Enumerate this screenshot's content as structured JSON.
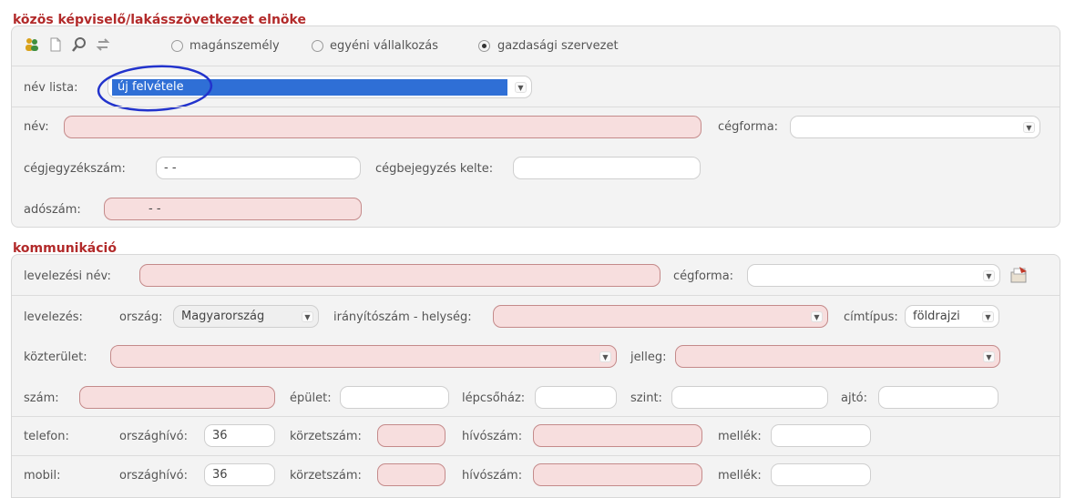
{
  "section1": {
    "title": "közös képviselő/lakásszövetkezet elnöke",
    "radios": {
      "option1": "magánszemély",
      "option2": "egyéni vállalkozás",
      "option3": "gazdasági szervezet",
      "selected": "gazdasági szervezet"
    },
    "name_list": {
      "label": "név lista:",
      "value": "új felvétele"
    },
    "name": {
      "label": "név:",
      "value": ""
    },
    "company_form": {
      "label": "cégforma:",
      "value": ""
    },
    "registry_number": {
      "label": "cégjegyzékszám:",
      "value": "-  -"
    },
    "registration_date": {
      "label": "cégbejegyzés kelte:",
      "value": ""
    },
    "tax_number": {
      "label": "adószám:",
      "value": "-  -"
    }
  },
  "section2": {
    "title": "kommunikáció",
    "mail_name": {
      "label": "levelezési név:",
      "value": ""
    },
    "company_form": {
      "label": "cégforma:",
      "value": ""
    },
    "mailing": {
      "label": "levelezés:",
      "country_label": "ország:",
      "country_value": "Magyarország",
      "zip_city_label": "irányítószám - helység:",
      "zip_city_value": "",
      "address_type_label": "címtípus:",
      "address_type_value": "földrajzi"
    },
    "public_place": {
      "label": "közterület:",
      "value": ""
    },
    "character": {
      "label": "jelleg:",
      "value": ""
    },
    "number": {
      "label": "szám:",
      "value": ""
    },
    "building": {
      "label": "épület:",
      "value": ""
    },
    "staircase": {
      "label": "lépcsőház:",
      "value": ""
    },
    "floor": {
      "label": "szint:",
      "value": ""
    },
    "door": {
      "label": "ajtó:",
      "value": ""
    },
    "phone": {
      "label": "telefon:",
      "country_code_label": "országhívó:",
      "country_code_value": "36",
      "area_code_label": "körzetszám:",
      "area_code_value": "",
      "number_label": "hívószám:",
      "number_value": "",
      "extension_label": "mellék:",
      "extension_value": ""
    },
    "mobile": {
      "label": "mobil:",
      "country_code_label": "országhívó:",
      "country_code_value": "36",
      "area_code_label": "körzetszám:",
      "area_code_value": "",
      "number_label": "hívószám:",
      "number_value": "",
      "extension_label": "mellék:",
      "extension_value": ""
    }
  },
  "colors": {
    "section_title": "#b22a2a",
    "required_bg": "#f7dede",
    "selection_blue": "#2f6fd6",
    "annotation_circle": "#2233cc"
  }
}
